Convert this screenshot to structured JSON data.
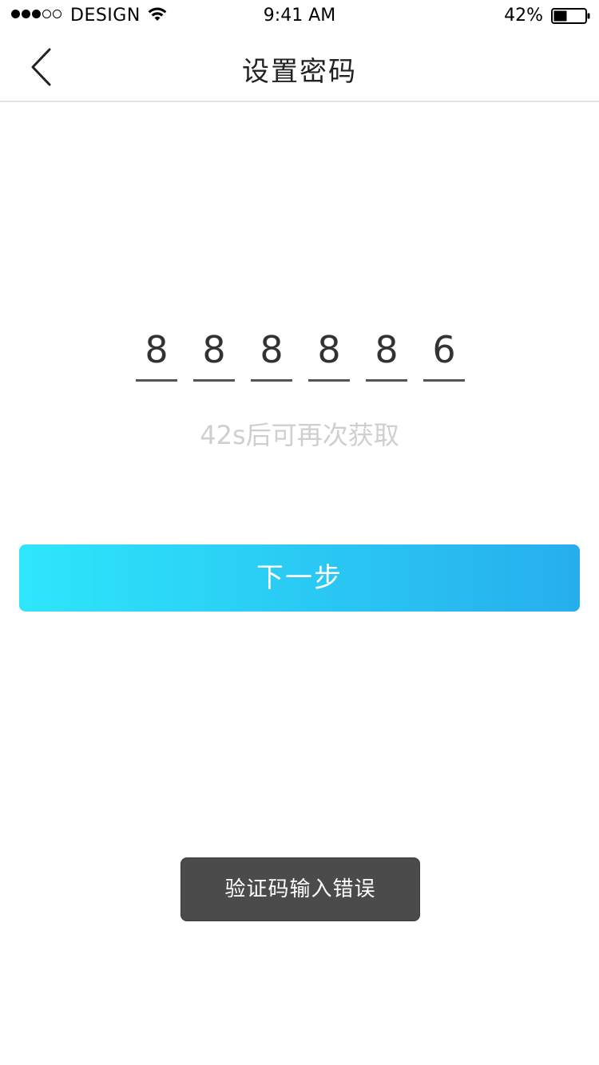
{
  "status_bar": {
    "signal_dots_filled": 3,
    "signal_dots_total": 5,
    "carrier": "DESIGN",
    "wifi_icon": "wifi-icon",
    "time": "9:41 AM",
    "battery_percent": "42%",
    "battery_level": 0.42,
    "battery_icon": "battery-icon"
  },
  "nav": {
    "back_icon": "chevron-left-icon",
    "title": "设置密码"
  },
  "code": {
    "digits": [
      "8",
      "8",
      "8",
      "8",
      "8",
      "6"
    ]
  },
  "resend_hint": "42s后可再次获取",
  "next_button": {
    "label": "下一步",
    "gradient_start": "#2ee6fb",
    "gradient_end": "#27aeed"
  },
  "toast": {
    "message": "验证码输入错误",
    "background": "#4b4b4b"
  }
}
